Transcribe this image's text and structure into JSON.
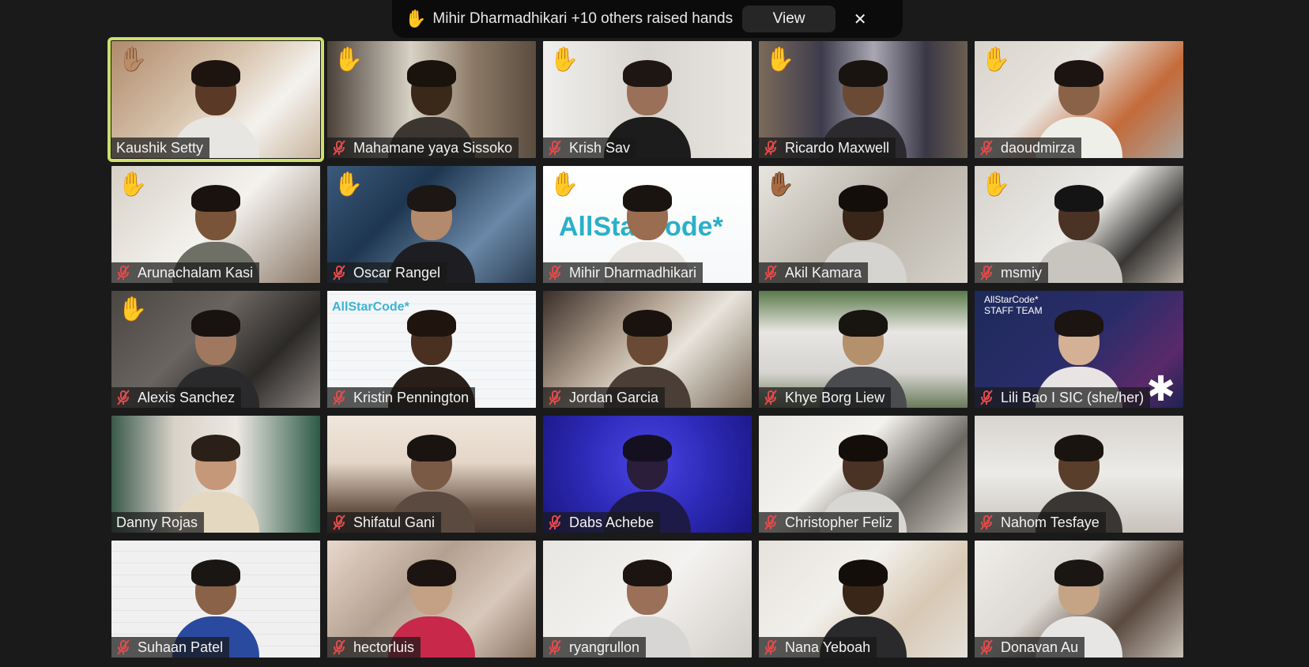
{
  "notification": {
    "hand_icon": "✋",
    "text": "Mihir Dharmadhikari +10 others raised hands",
    "view_label": "View",
    "close_icon": "✕"
  },
  "colors": {
    "background": "#1a1a1a",
    "active_speaker_border": "#cfe06a",
    "muted_icon": "#e04b4b",
    "hand_yellow": "#f3b634"
  },
  "participants": [
    {
      "name": "Kaushik Setty",
      "muted": false,
      "hand": "✋🏽",
      "active": true,
      "bg": "linear-gradient(135deg,#b08a6c 0%,#d9c6b0 45%,#f4f2ee 70%,#c9b59e 100%)",
      "skin": "#5a3a26",
      "hair": "#1d1410",
      "shirt": "#e8e6e2"
    },
    {
      "name": "Mahamane yaya Sissoko",
      "muted": true,
      "hand": "✋",
      "active": false,
      "bg": "linear-gradient(90deg,#4a4038 0%,#d8d2c6 40%,#8c7a66 70%,#5a4c40 100%)",
      "skin": "#3a2818",
      "hair": "#1a120c",
      "shirt": "#3c3630"
    },
    {
      "name": "Krish Sav",
      "muted": true,
      "hand": "✋",
      "active": false,
      "bg": "linear-gradient(90deg,#f0efed 0%,#d8d4cf 50%,#e9e6e2 100%)",
      "skin": "#9a7058",
      "hair": "#1e1612",
      "shirt": "#1c1c1c"
    },
    {
      "name": "Ricardo Maxwell",
      "muted": true,
      "hand": "✋",
      "active": false,
      "bg": "linear-gradient(90deg,#7c6a5a 0%,#3d3c4c 30%,#a9a7b2 55%,#3a3846 80%,#6a5e52 100%)",
      "skin": "#6a4a34",
      "hair": "#1a1410",
      "shirt": "#2c2a2e"
    },
    {
      "name": "daoudmirza",
      "muted": true,
      "hand": "✋",
      "active": false,
      "bg": "linear-gradient(135deg,#d8d4cc 0%,#e8e4de 40%,#c46a3a 70%,#a9a49c 100%)",
      "skin": "#8a6248",
      "hair": "#1c1410",
      "shirt": "#efefea"
    },
    {
      "name": "Arunachalam Kasi",
      "muted": true,
      "hand": "✋",
      "active": false,
      "bg": "linear-gradient(135deg,#d6d0c6 0%,#f4f2ee 50%,#8a7868 100%)",
      "skin": "#7a5438",
      "hair": "#1a120e",
      "shirt": "#6e7066"
    },
    {
      "name": "Oscar Rangel",
      "muted": true,
      "hand": "✋",
      "active": false,
      "bg": "linear-gradient(135deg,#3c5a7c 0%,#1e3650 35%,#6a88a8 70%,#2a3c50 100%)",
      "skin": "#b48a6c",
      "hair": "#1c1614",
      "shirt": "#1e1e22"
    },
    {
      "name": "Mihir Dharmadhikari",
      "muted": true,
      "hand": "✋",
      "active": false,
      "bg": "linear-gradient(180deg,#ffffff 0%,#f6f8f9 100%)",
      "skin": "#9a6c50",
      "hair": "#1a1410",
      "shirt": "#e6e2de",
      "logo": "AllStarCode*",
      "logoColor": "#2ab0c8",
      "logoSize": 34
    },
    {
      "name": "Akil Kamara",
      "muted": true,
      "hand": "✋🏾",
      "active": false,
      "bg": "linear-gradient(135deg,#e8e6e0 0%,#b8b2a8 50%,#d6d2ca 100%)",
      "skin": "#3a2618",
      "hair": "#140e0a",
      "shirt": "#d6d4d0"
    },
    {
      "name": "msmiy",
      "muted": true,
      "hand": "✋",
      "active": false,
      "bg": "linear-gradient(135deg,#d6d2cc 0%,#ecebe8 50%,#3a3836 75%,#b6aea4 100%)",
      "skin": "#4a3224",
      "hair": "#141414",
      "shirt": "#c8c4be"
    },
    {
      "name": "Alexis Sanchez",
      "muted": true,
      "hand": "✋",
      "active": false,
      "bg": "linear-gradient(135deg,#4a4642 0%,#6a6460 40%,#2c2a28 70%,#8a8480 100%)",
      "skin": "#a07860",
      "hair": "#181210",
      "shirt": "#2a2a2c"
    },
    {
      "name": "Kristin Pennington",
      "muted": true,
      "hand": "",
      "active": false,
      "bg": "repeating-linear-gradient(0deg,#f4f6f8 0px,#f4f6f8 11px,#dde3e8 12px),repeating-linear-gradient(90deg,#f4f6f8 0px,#f4f6f8 11px,#dde3e8 12px)",
      "skin": "#4a3020",
      "hair": "#20140e",
      "shirt": "#2a1e18",
      "logo": "AllStarCode*",
      "logoColor": "#3ab4d4",
      "logoSize": 16
    },
    {
      "name": "Jordan Garcia",
      "muted": true,
      "hand": "",
      "active": false,
      "bg": "linear-gradient(135deg,#3a2e28 0%,#b8a898 40%,#e8e4dc 60%,#7a6a5a 100%)",
      "skin": "#6a4a34",
      "hair": "#1a120e",
      "shirt": "#4a3e36"
    },
    {
      "name": "Khye Borg Liew",
      "muted": true,
      "hand": "",
      "active": false,
      "bg": "linear-gradient(180deg,#5a7a4a 0%,#e8e6e2 35%,#d6d4d0 70%,#6a7a5a 100%)",
      "skin": "#b4906c",
      "hair": "#181410",
      "shirt": "#4a4c50"
    },
    {
      "name": "Lili Bao I SIC (she/her)",
      "muted": true,
      "hand": "",
      "active": false,
      "bg": "linear-gradient(135deg,#1e2a5a 0%,#2a2c6a 50%,#5a2a6a 80%,#1e2250 100%)",
      "skin": "#d4b094",
      "hair": "#1c1410",
      "shirt": "#e8e4e4",
      "staff": "AllStarCode*\nSTAFF TEAM",
      "star": "✱"
    },
    {
      "name": "Danny Rojas",
      "muted": false,
      "hand": "",
      "active": false,
      "bg": "linear-gradient(90deg,#3a5a4a 0%,#d8d2c8 30%,#ece8e2 60%,#2e5a48 100%)",
      "skin": "#c49878",
      "hair": "#2a2018",
      "shirt": "#e4d8c0"
    },
    {
      "name": "Shifatul Gani",
      "muted": true,
      "hand": "",
      "active": false,
      "bg": "linear-gradient(180deg,#f0e6dc 0%,#e4d6c8 40%,#6a5446 80%,#4a3c34 100%)",
      "skin": "#7a5a44",
      "hair": "#1a1410",
      "shirt": "#5a4a40"
    },
    {
      "name": "Dabs Achebe",
      "muted": true,
      "hand": "",
      "active": false,
      "bg": "radial-gradient(circle at 50% 40%,#4a46e6 0%,#2e2ab8 50%,#1a1680 100%)",
      "skin": "#2a1e3a",
      "hair": "#141020",
      "shirt": "#1e1a48"
    },
    {
      "name": "Christopher Feliz",
      "muted": true,
      "hand": "",
      "active": false,
      "bg": "linear-gradient(135deg,#e8e6e2 0%,#f4f2ee 40%,#6a6660 70%,#c8c4bc 100%)",
      "skin": "#4a3224",
      "hair": "#140e0a",
      "shirt": "#d8d6d2"
    },
    {
      "name": "Nahom Tesfaye",
      "muted": true,
      "hand": "",
      "active": false,
      "bg": "linear-gradient(180deg,#d8d4ce 0%,#ecebe8 50%,#c8c2ba 100%)",
      "skin": "#5a3e2c",
      "hair": "#1a1410",
      "shirt": "#3a3634"
    },
    {
      "name": "Suhaan Patel",
      "muted": true,
      "hand": "",
      "active": false,
      "bg": "repeating-linear-gradient(0deg,#f0f0f0 0px,#f0f0f0 14px,#d8d8d8 15px)",
      "skin": "#8a6248",
      "hair": "#1a1614",
      "shirt": "#2a4aa0"
    },
    {
      "name": "hectorluis",
      "muted": true,
      "hand": "",
      "active": false,
      "bg": "linear-gradient(135deg,#e8d8cc 0%,#b4a090 40%,#d8c8bc 70%,#8a7464 100%)",
      "skin": "#c4a084",
      "hair": "#1c1410",
      "shirt": "#c8284a"
    },
    {
      "name": "ryangrullon",
      "muted": true,
      "hand": "",
      "active": false,
      "bg": "linear-gradient(135deg,#e8e6e2 0%,#f4f2f0 50%,#d0ccc6 100%)",
      "skin": "#9a7058",
      "hair": "#1c1410",
      "shirt": "#d8d6d4"
    },
    {
      "name": "Nana Yeboah",
      "muted": true,
      "hand": "",
      "active": false,
      "bg": "linear-gradient(135deg,#e6e2dc 0%,#f2f0ec 40%,#d8c8b4 70%,#e4e0da 100%)",
      "skin": "#3a2618",
      "hair": "#140e0a",
      "shirt": "#2a2a2c"
    },
    {
      "name": "Donavan Au",
      "muted": true,
      "hand": "",
      "active": false,
      "bg": "linear-gradient(135deg,#f0eeea 0%,#dcd8d2 40%,#5a4a40 70%,#c8c0b6 100%)",
      "skin": "#c4a484",
      "hair": "#1a1614",
      "shirt": "#e8e6e4"
    }
  ]
}
